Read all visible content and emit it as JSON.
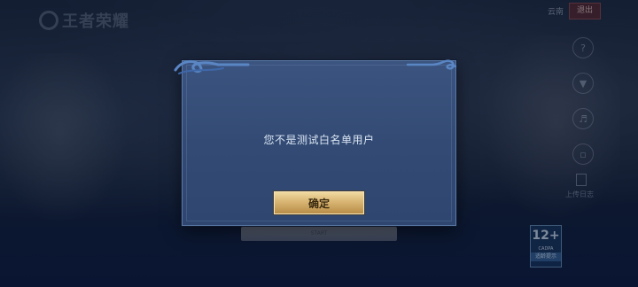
{
  "game": {
    "logo_text": "王者荣耀"
  },
  "topbar": {
    "region_label": "云南",
    "exit_label": "退出"
  },
  "sidebar": {
    "icons": [
      "help-icon",
      "download-icon",
      "volume-icon",
      "notice-icon",
      "log-icon"
    ],
    "log_label": "上传日志"
  },
  "login": {
    "start_label": "START"
  },
  "age_rating": {
    "number": "12+",
    "org": "CADPA",
    "label": "适龄提示"
  },
  "dialog": {
    "message": "您不是测试白名单用户",
    "confirm_label": "确定"
  },
  "colors": {
    "dialog_bg": "#334b74",
    "dialog_border": "#5b79a6",
    "confirm_gold": "#d8b573",
    "swirl": "#5a86c4"
  }
}
